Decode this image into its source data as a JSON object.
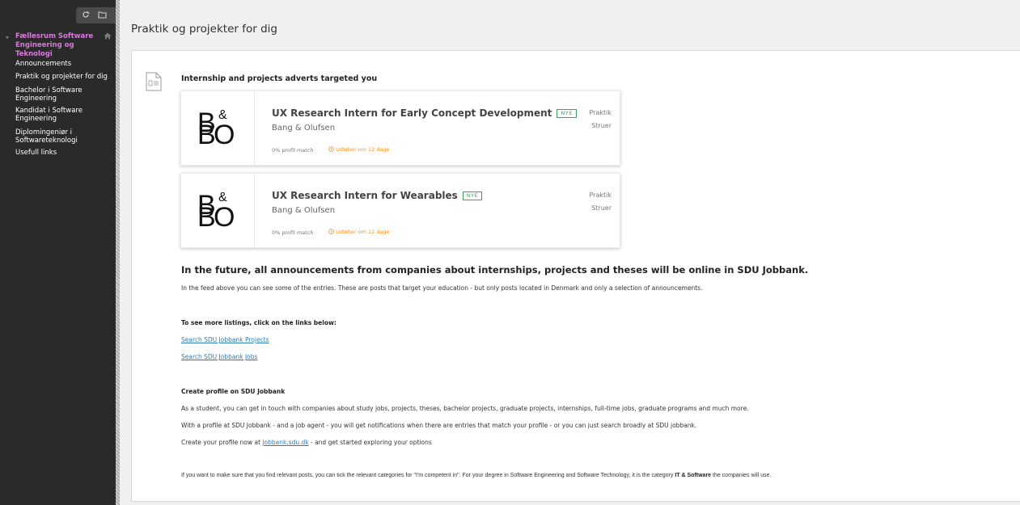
{
  "sidebar": {
    "course_title": "Fællesrum Software Engineering og Teknologi",
    "items": [
      {
        "label": "Announcements"
      },
      {
        "label": "Praktik og projekter for dig"
      },
      {
        "label": "Bachelor i Software Engineering"
      },
      {
        "label": "Kandidat i Software Engineering"
      },
      {
        "label": "Diplomingeniør i Softwareteknologi"
      },
      {
        "label": "Usefull links"
      }
    ],
    "icons": [
      "refresh-icon",
      "folder-icon",
      "home-icon"
    ],
    "accent_color": "#d67ad9"
  },
  "page": {
    "title": "Praktik og projekter for dig"
  },
  "feed": {
    "heading": "Internship and projects adverts targeted you",
    "jobs": [
      {
        "title": "UX Research Intern for Early Concept Development",
        "badge": "NYE",
        "company": "Bang & Olufsen",
        "match": "0% profil match",
        "expires": "Udløber om 12 dage",
        "type": "Praktik",
        "location": "Struer",
        "logo_b": "B",
        "logo_o": "O",
        "logo_amp": "&"
      },
      {
        "title": "UX Research Intern for Wearables",
        "badge": "NYE",
        "company": "Bang & Olufsen",
        "match": "0% profil match",
        "expires": "Udløber om 12 dage",
        "type": "Praktik",
        "location": "Struer",
        "logo_b": "B",
        "logo_o": "O",
        "logo_amp": "&"
      }
    ]
  },
  "info": {
    "heading": "In the future, all announcements from companies about internships, projects and theses will be online in SDU Jobbank.",
    "intro": "In the feed above you can see some of the entries. These are posts that target your education - but only posts located in Denmark and only a selection of announcements.",
    "links_heading": "To see more listings, click on the links below:",
    "link_projects": "Search SDU Jobbank Projects",
    "link_jobs": "Search SDU Jobbank Jobs",
    "profile_heading": "Create profile on SDU Jobbank",
    "profile_p1": "As a student, you can get in touch with companies about study jobs, projects, theses, bachelor projects, graduate projects, internships, full-time jobs, graduate programs and much more.",
    "profile_p2": "With a profile at SDU Jobbank - and a job agent - you will get notifications when there are entries that match your profile - or you can just search broadly at SDU jobbank.",
    "profile_p3_pre": "Create your profile now at ",
    "profile_p3_link": "jobbank.sdu.dk",
    "profile_p3_post": " - and get started exploring your options",
    "final_pre": "If you want to make sure that you find relevant posts, you can tick the relevant categories for \"I'm competent in\". For your degree in Software Engineering and Software Technology, it is the category ",
    "final_bold": "IT & Software",
    "final_post": " the companies will use."
  },
  "colors": {
    "badge_green": "#3aa35b",
    "expire_orange": "#f0962d",
    "link_blue": "#2e7bb3"
  }
}
